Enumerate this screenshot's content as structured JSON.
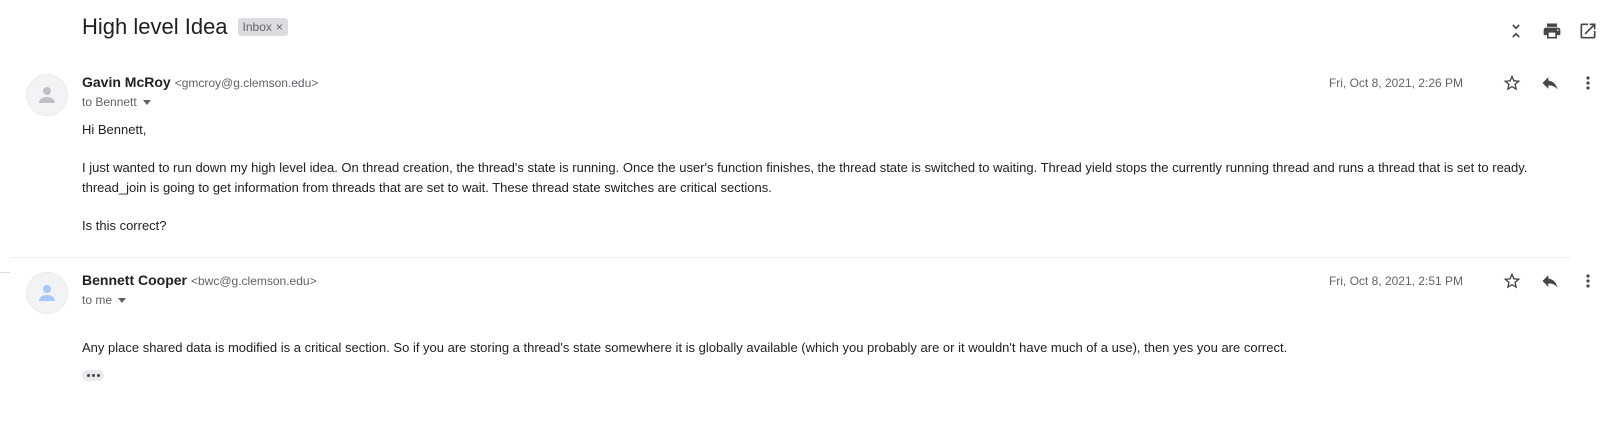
{
  "thread": {
    "subject": "High level Idea",
    "label": "Inbox",
    "label_remove": "×"
  },
  "messages": [
    {
      "sender_name": "Gavin McRoy",
      "sender_email": "<gmcroy@g.clemson.edu>",
      "to": "to Bennett",
      "timestamp": "Fri, Oct 8, 2021, 2:26 PM",
      "greeting": "Hi Bennett,",
      "paragraph1_line1": "I just wanted to run down my high level idea. On thread creation, the thread's state is running. Once the user's function finishes, the thread state is switched to waiting. Thread yield stops the currently running thread and runs a thread that is set to ready.",
      "paragraph1_line2": "thread_join is going to get information from threads that are set to wait. These thread state switches are critical sections.",
      "paragraph2": "Is this correct?"
    },
    {
      "sender_name": "Bennett Cooper",
      "sender_email": "<bwc@g.clemson.edu>",
      "to": "to me",
      "timestamp": "Fri, Oct 8, 2021, 2:51 PM",
      "paragraph1": "Any place shared data is modified is a critical section. So if you are storing a thread's state somewhere it is globally available (which you probably are or it wouldn't have much of a use), then yes you are correct."
    }
  ],
  "icons": {
    "collapse": "collapse-all-icon",
    "print": "print-icon",
    "open_new": "open-in-new-window-icon",
    "star": "star-icon",
    "reply": "reply-icon",
    "more": "more-vert-icon",
    "avatar": "person-icon"
  },
  "colors": {
    "avatar_person": "#a8c7fa",
    "chip_bg": "#dadce0"
  }
}
